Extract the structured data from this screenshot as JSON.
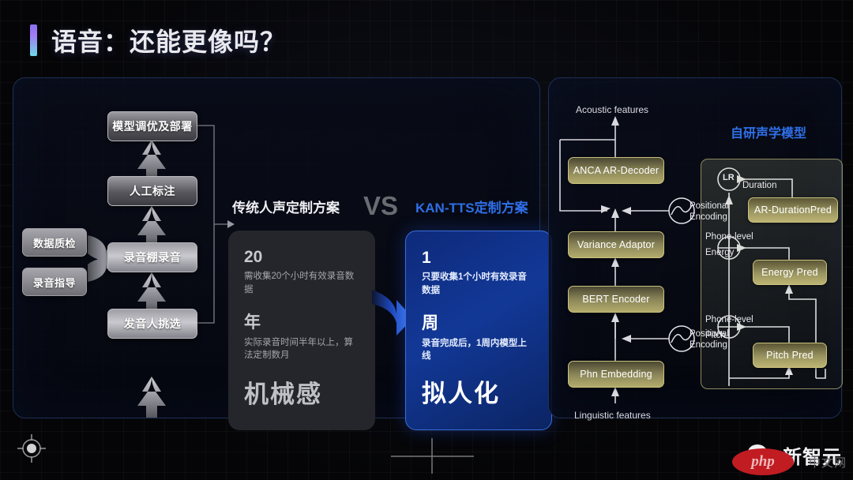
{
  "header": {
    "title": "语音：还能更像吗？",
    "accent_gradient_from": "#8b6ff0",
    "accent_gradient_to": "#6fd8e8"
  },
  "left_panel": {
    "flow": {
      "main_steps": [
        {
          "id": "deploy",
          "label": "模型调优及部署"
        },
        {
          "id": "label",
          "label": "人工标注"
        },
        {
          "id": "studio",
          "label": "录音棚录音"
        },
        {
          "id": "select",
          "label": "发音人挑选"
        }
      ],
      "side_steps": [
        {
          "id": "qc",
          "label": "数据质检"
        },
        {
          "id": "guide",
          "label": "录音指导"
        }
      ]
    },
    "comparison": {
      "left_heading": "传统人声定制方案",
      "vs_label": "VS",
      "right_heading": "KAN-TTS定制方案",
      "traditional_card": {
        "metric_1_value": "20",
        "metric_1_desc": "需收集20个小时有效录音数据",
        "metric_2_value": "年",
        "metric_2_desc": "实际录音时间半年以上，算法定制数月",
        "tagline": "机械感"
      },
      "kan_card": {
        "metric_1_value": "1",
        "metric_1_desc": "只要收集1个小时有效录音数据",
        "metric_2_value": "周",
        "metric_2_desc": "录音完成后，1周内模型上线",
        "tagline": "拟人化"
      },
      "accent_blue": "#2f6fe8"
    }
  },
  "right_panel": {
    "title": "自研声学模型",
    "top_label": "Acoustic features",
    "bottom_label": "Linguistic features",
    "blocks": [
      {
        "id": "anca",
        "label": "ANCA AR-Decoder"
      },
      {
        "id": "var",
        "label": "Variance Adaptor"
      },
      {
        "id": "bert",
        "label": "BERT Encoder"
      },
      {
        "id": "phn",
        "label": "Phn Embedding"
      }
    ],
    "positional_encoding": {
      "line_1": "Positional",
      "line_2": "Encoding",
      "icon": "sine-wave-circle-icon"
    },
    "variance_adaptor_detail": {
      "lr_node": "LR",
      "duration_label": "Duration",
      "duration_block": "AR-DurationPred",
      "energy_label_1": "Phone-level",
      "energy_label_2": "Energy",
      "energy_block": "Energy Pred",
      "pitch_label_1": "Phone-level",
      "pitch_label_2": "Pitch",
      "pitch_block": "Pitch Pred",
      "sum_node": "⊕"
    }
  },
  "watermark": {
    "account_name": "新智元",
    "wechat_icon": "wechat-icon",
    "php_badge": "php",
    "site_mark": "中文网"
  }
}
